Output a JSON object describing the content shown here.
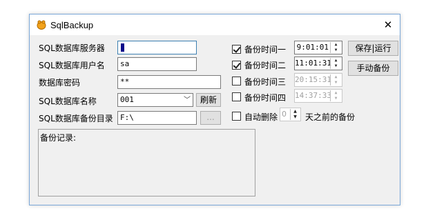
{
  "window": {
    "title": "SqlBackup",
    "close_symbol": "✕"
  },
  "form": {
    "server_label": "SQL数据库服务器",
    "user_label": "SQL数据库用户名",
    "user_value": "sa",
    "password_label": "数据库密码",
    "password_value": "**",
    "dbname_label": "SQL数据库名称",
    "dbname_value": "001",
    "refresh_button": "刷新",
    "dir_label": "SQL数据库备份目录",
    "dir_value": "F:\\",
    "browse_button": "..."
  },
  "schedule": [
    {
      "label": "备份时间一",
      "checked": true,
      "time": "9:01:01",
      "enabled": true
    },
    {
      "label": "备份时间二",
      "checked": true,
      "time": "11:01:31",
      "enabled": true
    },
    {
      "label": "备份时间三",
      "checked": false,
      "time": "20:15:31",
      "enabled": false
    },
    {
      "label": "备份时间四",
      "checked": false,
      "time": "14:37:33",
      "enabled": false
    }
  ],
  "auto_delete": {
    "label": "自动删除",
    "days": "0",
    "suffix": "天之前的备份",
    "checked": false
  },
  "buttons": {
    "save_run": "保存|运行",
    "manual_backup": "手动备份"
  },
  "log": {
    "title": "备份记录:"
  }
}
